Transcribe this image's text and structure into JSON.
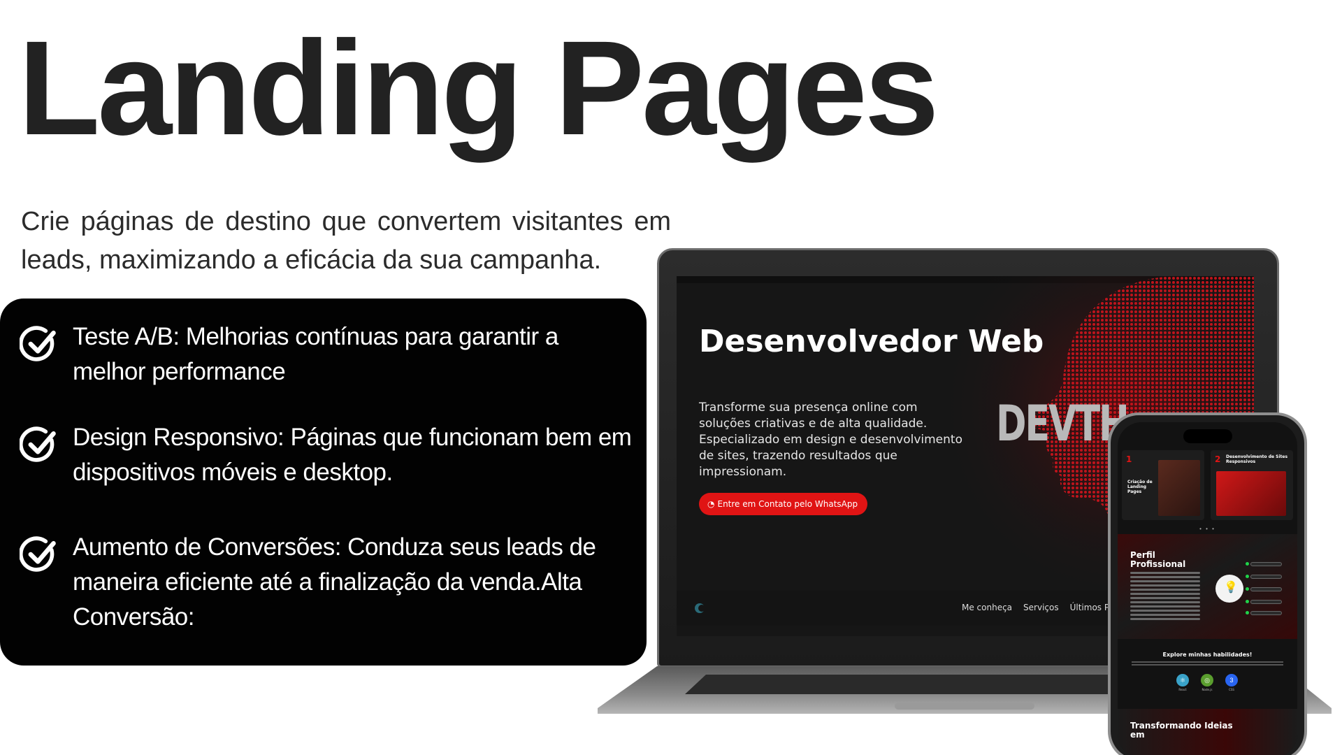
{
  "header": {
    "title": "Landing Pages",
    "subtitle": "Crie páginas de destino que convertem visitantes em leads, maximizando a eficácia da sua campanha."
  },
  "features": [
    {
      "icon": "check-circle-icon",
      "text": "Teste A/B: Melhorias contínuas para garantir a melhor performance"
    },
    {
      "icon": "check-circle-icon",
      "text": "Design Responsivo: Páginas que funcionam bem em dispositivos móveis e desktop."
    },
    {
      "icon": "check-circle-icon",
      "text": "Aumento de Conversões: Conduza seus leads de maneira eficiente até a finalização da venda.Alta Conversão:"
    }
  ],
  "laptop_screen": {
    "title": "Desenvolvedor Web",
    "description": "Transforme sua presença online com soluções criativas e de alta qualidade. Especializado em design e desenvolvimento de sites, trazendo resultados que impressionam.",
    "cta_label": "Entre em Contato pelo WhatsApp",
    "brand_text": "DEVTH",
    "nav": [
      "Me conheça",
      "Serviços",
      "Últimos Pro"
    ]
  },
  "phone_screen": {
    "services": [
      {
        "number": "1",
        "label": "Criação de Landing Pages"
      },
      {
        "number": "2",
        "label": "Desenvolvimento de Sites Responsivos"
      }
    ],
    "profile_title": "Perfil Profissional",
    "skills_title": "Explore minhas habilidades!",
    "tech_labels": [
      "React",
      "Node.js",
      "CSS"
    ],
    "bottom_title": "Transformando Ideias em"
  },
  "colors": {
    "accent_red": "#e01414",
    "card_bg": "#020202",
    "title_text": "#222222"
  }
}
